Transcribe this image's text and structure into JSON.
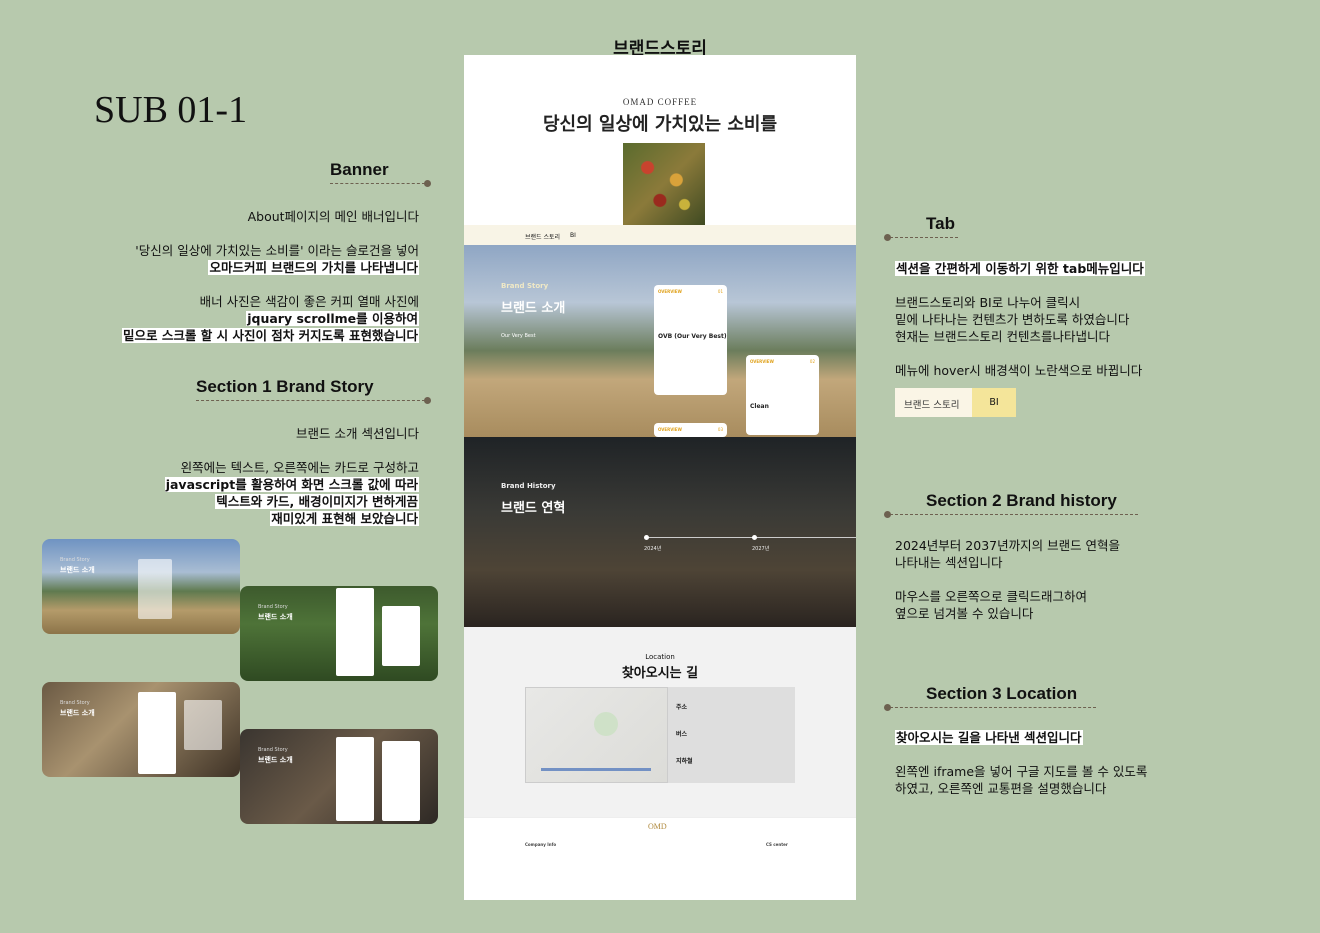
{
  "header": {
    "sub_title": "SUB 01-1",
    "page_title": "브랜드스토리"
  },
  "annotations": {
    "banner": {
      "heading": "Banner",
      "p1": "About페이지의 메인 배너입니다",
      "p2a": "'당신의 일상에 가치있는 소비를' 이라는 슬로건을 넣어",
      "p2b": "오마드커피 브랜드의 가치를 나타냅니다",
      "p3a": "배너 사진은 색감이 좋은 커피 열매 사진에",
      "p3b": "jquary scrollme를 이용하여",
      "p3c": "밑으로 스크롤 할 시 사진이 점차 커지도록 표현했습니다"
    },
    "section1": {
      "heading": "Section 1   Brand Story",
      "p1": "브랜드 소개 섹션입니다",
      "p2a": "왼쪽에는 텍스트, 오른쪽에는 카드로 구성하고",
      "p2b": "javascript를 활용하여 화면 스크롤 값에 따라",
      "p2c": "텍스트와 카드, 배경이미지가 변하게끔",
      "p2d": "재미있게 표현해 보았습니다"
    },
    "tab": {
      "heading": "Tab",
      "p1": "섹션을 간편하게 이동하기 위한 tab메뉴입니다",
      "p2a": "브랜드스토리와 BI로 나누어 클릭시",
      "p2b": "밑에 나타나는 컨텐츠가 변하도록 하였습니다",
      "p2c": "현재는 브랜드스토리 컨텐츠를나타냅니다",
      "p3": "메뉴에 hover시 배경색이 노란색으로 바뀝니다",
      "tab1": "브랜드 스토리",
      "tab2": "BI"
    },
    "section2": {
      "heading": "Section 2   Brand history",
      "p1a": "2024년부터 2037년까지의 브랜드 연혁을",
      "p1b": "나타내는 섹션입니다",
      "p2a": "마우스를 오른쪽으로 클릭드래그하여",
      "p2b": "옆으로 넘겨볼 수 있습니다"
    },
    "section3": {
      "heading": "Section 3   Location",
      "p1": "찾아오시는 길을 나타낸 섹션입니다",
      "p2a": "왼쪽엔 iframe을 넣어 구글 지도를 볼 수 있도록",
      "p2b": "하였고, 오른쪽엔 교통편을 설명했습니다"
    }
  },
  "mockup": {
    "logo_text": "OMAD COFFEE",
    "slogan": "당신의 일상에 가치있는 소비를",
    "tabs": [
      "브랜드 스토리",
      "BI"
    ],
    "brand_story": {
      "label": "Brand Story",
      "title": "브랜드 소개",
      "sub": "Our Very Best",
      "cards": [
        {
          "tag": "OVERVIEW",
          "num": "01",
          "name": "OVB (Our Very Best)"
        },
        {
          "tag": "OVERVIEW",
          "num": "02",
          "name": "Clean"
        },
        {
          "tag": "OVERVIEW",
          "num": "03",
          "name": ""
        }
      ]
    },
    "brand_history": {
      "label": "Brand History",
      "title": "브랜드 연혁",
      "years": [
        "2024년",
        "2027년"
      ]
    },
    "location": {
      "label": "Location",
      "title": "찾아오시는 길",
      "info_titles": [
        "주소",
        "버스",
        "지하철"
      ]
    },
    "footer": {
      "logo": "OMD",
      "company_info": "Company Info",
      "cs_center": "CS center"
    }
  },
  "thumbnails": [
    {
      "label": "Brand Story",
      "title": "브랜드 소개"
    },
    {
      "label": "Brand Story",
      "title": "브랜드 소개"
    },
    {
      "label": "Brand Story",
      "title": "브랜드 소개"
    },
    {
      "label": "Brand Story",
      "title": "브랜드 소개"
    }
  ]
}
